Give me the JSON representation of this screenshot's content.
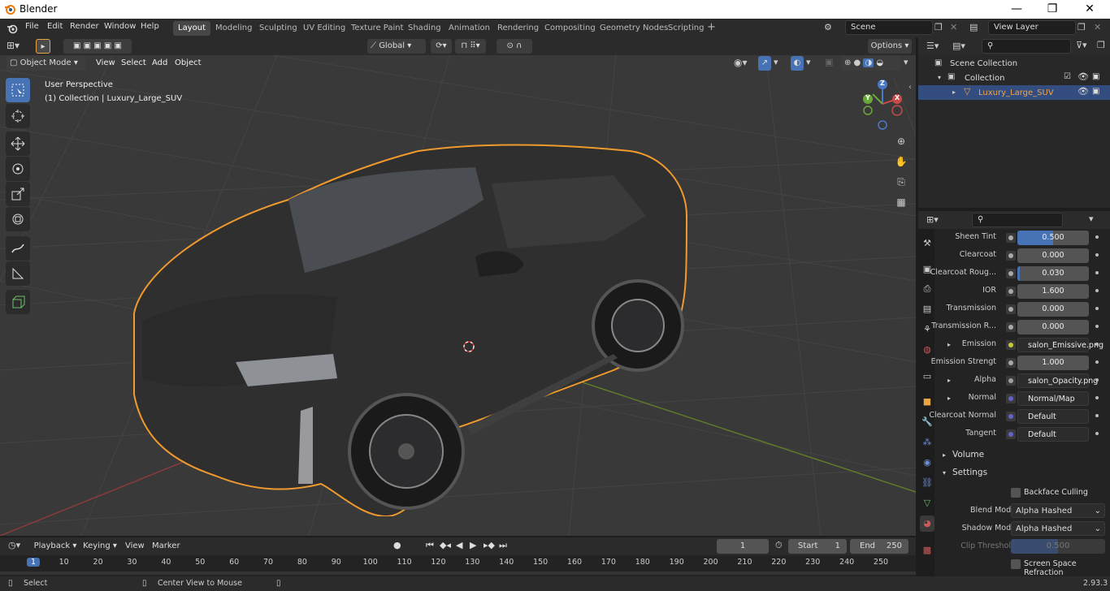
{
  "window": {
    "app_name": "Blender",
    "minimize": "—",
    "maximize": "❐",
    "close": "✕"
  },
  "menu": {
    "items": [
      "File",
      "Edit",
      "Render",
      "Window",
      "Help"
    ]
  },
  "workspaces": {
    "tabs": [
      "Layout",
      "Modeling",
      "Sculpting",
      "UV Editing",
      "Texture Paint",
      "Shading",
      "Animation",
      "Rendering",
      "Compositing",
      "Geometry Nodes",
      "Scripting"
    ],
    "active": "Layout"
  },
  "scene": {
    "name": "Scene",
    "view_layer": "View Layer"
  },
  "viewport": {
    "mode": "Object Mode",
    "header_menus": [
      "View",
      "Select",
      "Add",
      "Object"
    ],
    "orientation": "Global",
    "options_label": "Options",
    "overlay_title": "User Perspective",
    "overlay_subtitle": "(1) Collection | Luxury_Large_SUV",
    "gizmo": {
      "z": "Z",
      "y": "Y",
      "x": "X"
    }
  },
  "outliner": {
    "root": "Scene Collection",
    "collection": "Collection",
    "object": "Luxury_Large_SUV"
  },
  "properties": {
    "rows": [
      {
        "label": "Sheen Tint",
        "value": "0.500",
        "kind": "slider",
        "fill": 0.5
      },
      {
        "label": "Clearcoat",
        "value": "0.000",
        "kind": "slider",
        "fill": 0
      },
      {
        "label": "Clearcoat Roug...",
        "value": "0.030",
        "kind": "slider",
        "fill": 0.03
      },
      {
        "label": "IOR",
        "value": "1.600",
        "kind": "number"
      },
      {
        "label": "Transmission",
        "value": "0.000",
        "kind": "slider",
        "fill": 0
      },
      {
        "label": "Transmission R...",
        "value": "0.000",
        "kind": "slider",
        "fill": 0
      },
      {
        "label": "Emission",
        "value": "salon_Emissive.png",
        "kind": "link",
        "expand": true,
        "socket": "#c8c83c"
      },
      {
        "label": "Emission Strengt",
        "value": "1.000",
        "kind": "number"
      },
      {
        "label": "Alpha",
        "value": "salon_Opacity.png",
        "kind": "link",
        "expand": true,
        "socket": "#a0a0a0"
      },
      {
        "label": "Normal",
        "value": "Normal/Map",
        "kind": "link",
        "expand": true,
        "socket": "#6363c7"
      },
      {
        "label": "Clearcoat Normal",
        "value": "Default",
        "kind": "link",
        "socket": "#6363c7"
      },
      {
        "label": "Tangent",
        "value": "Default",
        "kind": "link",
        "socket": "#6363c7"
      }
    ],
    "section_volume": "Volume",
    "section_settings": "Settings",
    "backface_culling": "Backface Culling",
    "blend_mode_label": "Blend Mode",
    "blend_mode_value": "Alpha Hashed",
    "shadow_mode_label": "Shadow Mode",
    "shadow_mode_value": "Alpha Hashed",
    "clip_threshold_label": "Clip Threshold",
    "clip_threshold_value": "0.500",
    "ssr_label": "Screen Space Refraction"
  },
  "timeline": {
    "menus": [
      "Playback",
      "Keying",
      "View",
      "Marker"
    ],
    "current_frame": "1",
    "start_label": "Start",
    "start_value": "1",
    "end_label": "End",
    "end_value": "250",
    "ruler": [
      "1",
      "10",
      "20",
      "30",
      "40",
      "50",
      "60",
      "70",
      "80",
      "90",
      "100",
      "110",
      "120",
      "130",
      "140",
      "150",
      "160",
      "170",
      "180",
      "190",
      "200",
      "210",
      "220",
      "230",
      "240",
      "250"
    ]
  },
  "status": {
    "left": "Select",
    "middle": "Center View to Mouse",
    "version": "2.93.3"
  },
  "colors": {
    "accent": "#4772b3",
    "selection_outline": "#f09a2e",
    "header_bg": "#2b2b2b",
    "viewport_bg": "#393939"
  }
}
